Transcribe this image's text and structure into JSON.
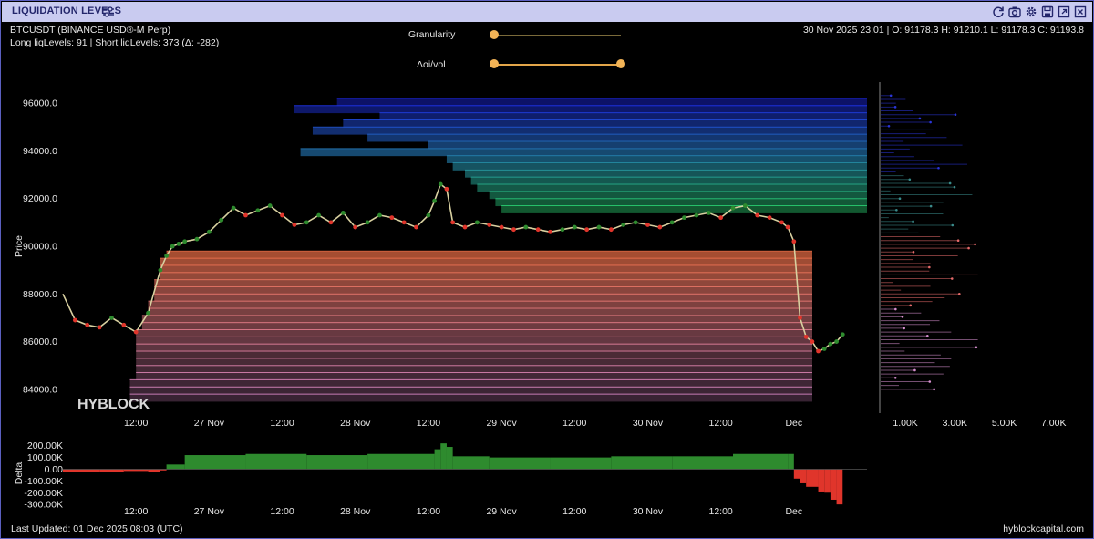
{
  "window": {
    "title": "LIQUIDATION LEVELS"
  },
  "toolbar": {
    "icons": [
      "sliders-icon",
      "refresh-icon",
      "camera-icon",
      "gear-icon",
      "save-icon",
      "expand-icon",
      "close-icon"
    ]
  },
  "header": {
    "symbol": "BTCUSDT (BINANCE USD®-M Perp)",
    "levels": "Long liqLevels: 91 | Short liqLevels: 373 (Δ: -282)",
    "ohlc": "30 Nov 2025 23:01 | O: 91178.3 H: 91210.1 L: 91178.3 C: 91193.8"
  },
  "controls": {
    "granularity_label": "Granularity",
    "granularity_value": 0.0,
    "oi_vol_label": "Δoi/vol",
    "oi_vol_range": [
      0.0,
      1.0
    ]
  },
  "footer": {
    "last_updated": "Last Updated: 01 Dec 2025 08:03 (UTC)",
    "brand": "hyblockcapital.com"
  },
  "watermark": "HYBLOCK",
  "colors": {
    "bull": "#2e8b2e",
    "bear": "#e0352b",
    "short_liq": "#2a35d8",
    "long_liq": "#e86a7a",
    "accent": "#f2b356"
  },
  "chart_data": [
    {
      "type": "line",
      "name": "price-chart",
      "ylabel": "Price",
      "ylim": [
        83000,
        97000
      ],
      "yticks": [
        84000,
        86000,
        88000,
        90000,
        92000,
        94000,
        96000
      ],
      "ytick_labels": [
        "84000.0",
        "86000.0",
        "88000.0",
        "90000.0",
        "92000.0",
        "94000.0",
        "96000.0"
      ],
      "xlim": [
        0,
        132
      ],
      "xticks": [
        12,
        24,
        36,
        48,
        60,
        72,
        84,
        96,
        108,
        120
      ],
      "xtick_labels": [
        "12:00",
        "27 Nov",
        "12:00",
        "28 Nov",
        "12:00",
        "29 Nov",
        "12:00",
        "30 Nov",
        "12:00",
        "Dec"
      ],
      "x_unit": "hours since 26 Nov 00:00",
      "price_x": [
        0,
        2,
        4,
        6,
        8,
        10,
        12,
        14,
        16,
        17,
        18,
        19,
        20,
        22,
        24,
        26,
        28,
        30,
        32,
        34,
        36,
        38,
        40,
        42,
        44,
        46,
        48,
        50,
        52,
        54,
        56,
        58,
        60,
        61,
        62,
        63,
        64,
        66,
        68,
        70,
        72,
        74,
        76,
        78,
        80,
        82,
        84,
        86,
        88,
        90,
        92,
        94,
        96,
        98,
        100,
        102,
        104,
        106,
        108,
        110,
        112,
        114,
        116,
        118,
        119,
        120,
        121,
        122,
        123,
        124,
        125,
        126,
        127,
        128
      ],
      "price_y": [
        88000,
        86900,
        86700,
        86600,
        87000,
        86700,
        86400,
        87200,
        89000,
        89600,
        90000,
        90100,
        90200,
        90300,
        90600,
        91100,
        91600,
        91300,
        91500,
        91700,
        91300,
        90900,
        91000,
        91300,
        91000,
        91400,
        90800,
        91000,
        91300,
        91200,
        91000,
        90800,
        91300,
        91900,
        92600,
        92400,
        91000,
        90800,
        91000,
        90900,
        90800,
        90700,
        90800,
        90700,
        90600,
        90700,
        90800,
        90700,
        90800,
        90700,
        90900,
        91000,
        90900,
        90800,
        91000,
        91200,
        91300,
        91400,
        91200,
        91600,
        91700,
        91300,
        91200,
        91000,
        90800,
        90200,
        87000,
        86200,
        86000,
        85600,
        85700,
        85900,
        86000,
        86300
      ],
      "short_liq_levels": {
        "name": "short liqLevels",
        "prices": [
          96200,
          95900,
          95600,
          95300,
          95000,
          94700,
          94400,
          94100,
          93800,
          93500,
          93200,
          92900,
          92600,
          92300,
          92000,
          91700
        ],
        "start_x": [
          45,
          38,
          52,
          46,
          41,
          50,
          60,
          39,
          63,
          64,
          66,
          67,
          68,
          70,
          71,
          72
        ]
      },
      "long_liq_levels": {
        "name": "long liqLevels",
        "prices": [
          89800,
          89500,
          89200,
          88900,
          88600,
          88300,
          88000,
          87700,
          87400,
          87100,
          86800,
          86500,
          86200,
          85900,
          85600,
          85300,
          85000,
          84700,
          84400,
          84100,
          83800
        ],
        "start_x": [
          17,
          16,
          16,
          16,
          15,
          15,
          15,
          14,
          14,
          13,
          13,
          12,
          12,
          12,
          12,
          12,
          12,
          12,
          11,
          11,
          11
        ]
      }
    },
    {
      "type": "bar",
      "name": "volume-profile",
      "xtick_labels": [
        "1.00K",
        "3.00K",
        "5.00K",
        "7.00K"
      ],
      "xticks": [
        1000,
        3000,
        5000,
        7000
      ],
      "xlim": [
        0,
        8300
      ]
    },
    {
      "type": "area",
      "name": "delta-chart",
      "ylabel": "Delta",
      "ylim": [
        -330000,
        260000
      ],
      "yticks": [
        200000,
        100000,
        0,
        -100000,
        -200000,
        -300000
      ],
      "ytick_labels": [
        "200.00K",
        "100.00K",
        "0.00",
        "-100.00K",
        "-200.00K",
        "-300.00K"
      ],
      "xtick_labels": [
        "12:00",
        "27 Nov",
        "12:00",
        "28 Nov",
        "12:00",
        "29 Nov",
        "12:00",
        "30 Nov",
        "12:00",
        "Dec"
      ],
      "x": [
        0,
        6,
        10,
        14,
        16,
        17,
        20,
        30,
        40,
        50,
        60,
        61,
        62,
        63,
        64,
        70,
        80,
        90,
        100,
        110,
        119,
        120,
        121,
        122,
        124,
        125,
        126,
        127,
        128
      ],
      "values": [
        -20000,
        -20000,
        -15000,
        -20000,
        -10000,
        40000,
        120000,
        130000,
        120000,
        130000,
        130000,
        170000,
        220000,
        190000,
        110000,
        100000,
        100000,
        110000,
        110000,
        130000,
        130000,
        -80000,
        -120000,
        -150000,
        -190000,
        -200000,
        -260000,
        -300000,
        -300000
      ]
    }
  ]
}
